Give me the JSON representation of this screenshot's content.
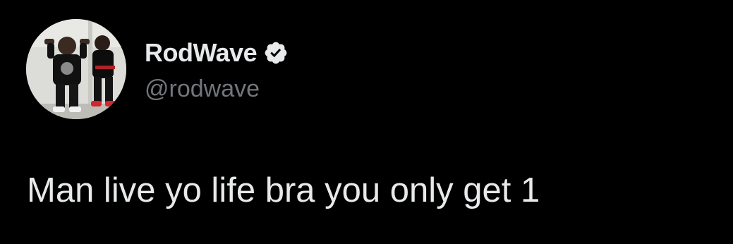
{
  "author": {
    "display_name": "RodWave",
    "handle": "@rodwave",
    "verified": true,
    "verified_icon": "verified-badge-icon",
    "avatar": "profile-photo"
  },
  "tweet": {
    "text": "Man live yo life bra you only get 1"
  },
  "colors": {
    "background": "#000000",
    "primary_text": "#e7e9ea",
    "secondary_text": "#71767b",
    "badge_fill": "#e7e9ea",
    "badge_check": "#000000"
  }
}
